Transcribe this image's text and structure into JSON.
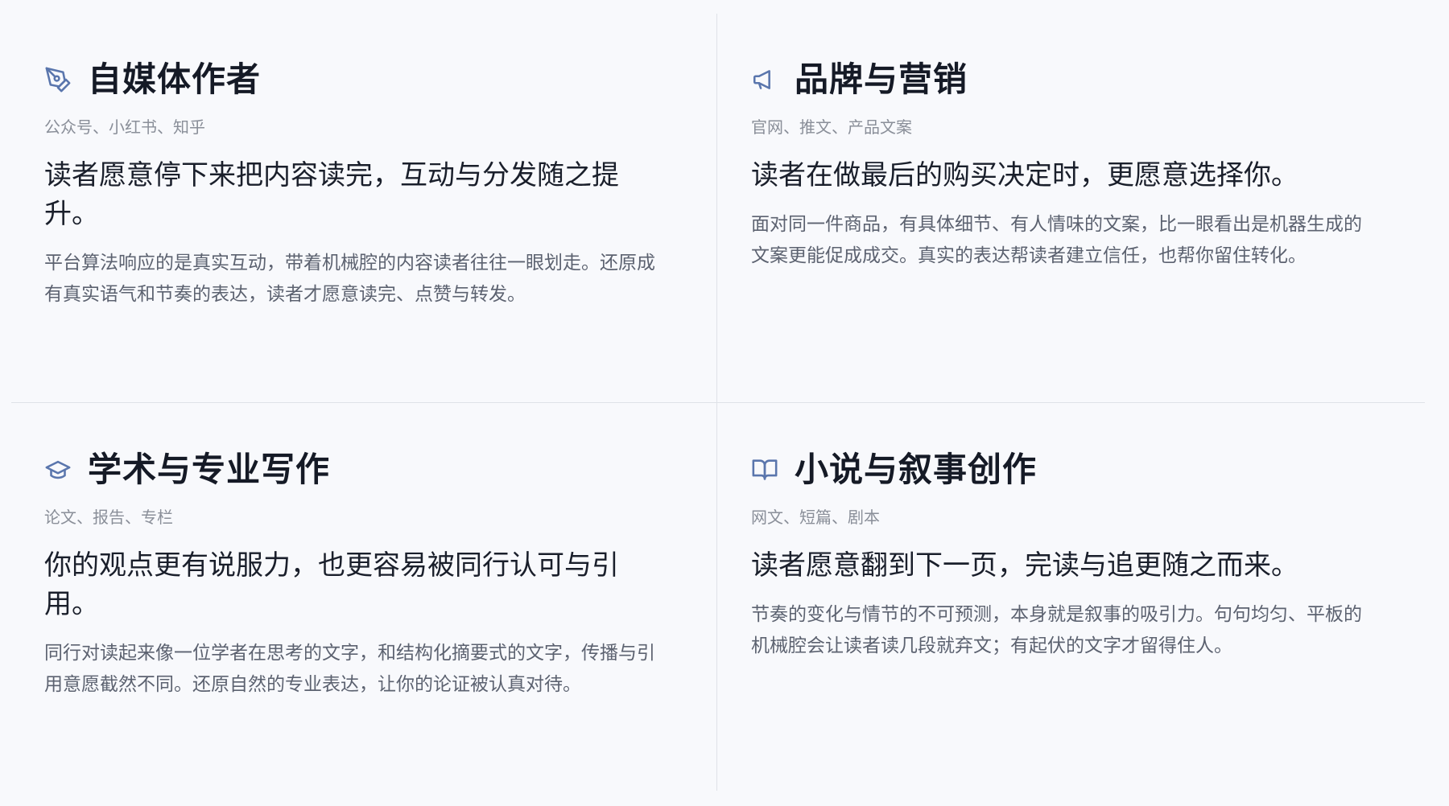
{
  "colors": {
    "background": "#f8f9fc",
    "divider": "#dfe2e8",
    "icon_accent": "#5a76ad",
    "title": "#151a26",
    "tags": "#8a8f99",
    "body": "#5c6270"
  },
  "cards": [
    {
      "icon": "pen-nib-icon",
      "title": "自媒体作者",
      "tags": "公众号、小红书、知乎",
      "headline": "读者愿意停下来把内容读完，互动与分发随之提升。",
      "body": "平台算法响应的是真实互动，带着机械腔的内容读者往往一眼划走。还原成有真实语气和节奏的表达，读者才愿意读完、点赞与转发。"
    },
    {
      "icon": "megaphone-icon",
      "title": "品牌与营销",
      "tags": "官网、推文、产品文案",
      "headline": "读者在做最后的购买决定时，更愿意选择你。",
      "body": "面对同一件商品，有具体细节、有人情味的文案，比一眼看出是机器生成的文案更能促成成交。真实的表达帮读者建立信任，也帮你留住转化。"
    },
    {
      "icon": "graduation-cap-icon",
      "title": "学术与专业写作",
      "tags": "论文、报告、专栏",
      "headline": "你的观点更有说服力，也更容易被同行认可与引用。",
      "body": "同行对读起来像一位学者在思考的文字，和结构化摘要式的文字，传播与引用意愿截然不同。还原自然的专业表达，让你的论证被认真对待。"
    },
    {
      "icon": "open-book-icon",
      "title": "小说与叙事创作",
      "tags": "网文、短篇、剧本",
      "headline": "读者愿意翻到下一页，完读与追更随之而来。",
      "body": "节奏的变化与情节的不可预测，本身就是叙事的吸引力。句句均匀、平板的机械腔会让读者读几段就弃文；有起伏的文字才留得住人。"
    }
  ]
}
